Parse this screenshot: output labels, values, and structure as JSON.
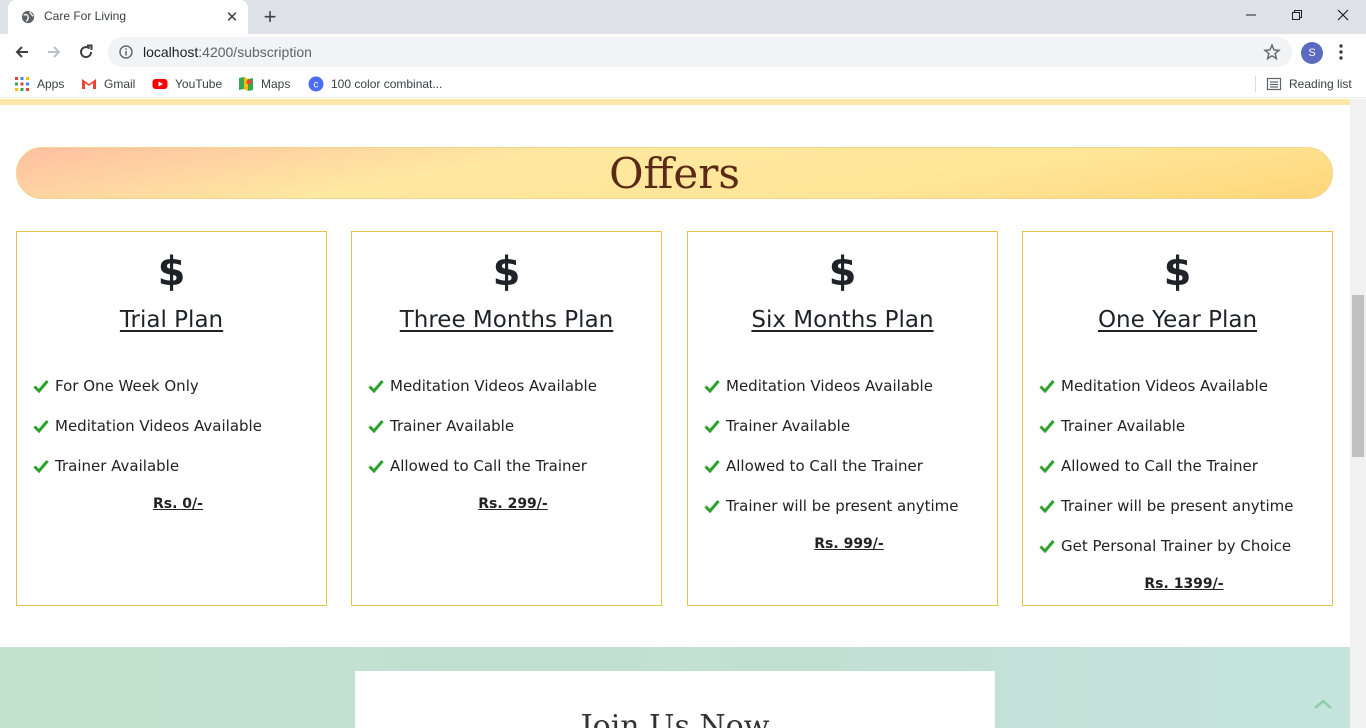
{
  "browser": {
    "tab_title": "Care For Living",
    "tab_close": "✕",
    "new_tab": "+",
    "url_host": "localhost",
    "url_path": ":4200/subscription",
    "profile_initial": "S",
    "bookmarks": [
      {
        "label": "Apps",
        "icon": "apps-grid-icon"
      },
      {
        "label": "Gmail",
        "icon": "gmail-icon"
      },
      {
        "label": "YouTube",
        "icon": "youtube-icon"
      },
      {
        "label": "Maps",
        "icon": "maps-icon"
      },
      {
        "label": "100 color combinat...",
        "icon": "color-site-icon"
      }
    ],
    "reading_list": "Reading list"
  },
  "page": {
    "offers_title": "Offers",
    "currency_symbol": "$",
    "plans": [
      {
        "title": "Trial Plan",
        "features": [
          "For One Week Only",
          "Meditation Videos Available",
          "Trainer Available"
        ],
        "price": "Rs. 0/-"
      },
      {
        "title": "Three Months Plan",
        "features": [
          "Meditation Videos Available",
          "Trainer Available",
          "Allowed to Call the Trainer"
        ],
        "price": "Rs. 299/-"
      },
      {
        "title": "Six Months Plan",
        "features": [
          "Meditation Videos Available",
          "Trainer Available",
          "Allowed to Call the Trainer",
          "Trainer will be present anytime"
        ],
        "price": "Rs. 999/-"
      },
      {
        "title": "One Year Plan",
        "features": [
          "Meditation Videos Available",
          "Trainer Available",
          "Allowed to Call the Trainer",
          "Trainer will be present anytime",
          "Get Personal Trainer by Choice"
        ],
        "price": "Rs. 1399/-"
      }
    ],
    "join_title": "Join Us Now"
  },
  "colors": {
    "card_border": "#e8c24a",
    "check_green": "#2ea02e",
    "offers_text": "#5a2a16",
    "join_bg": "#c3e2cd"
  }
}
